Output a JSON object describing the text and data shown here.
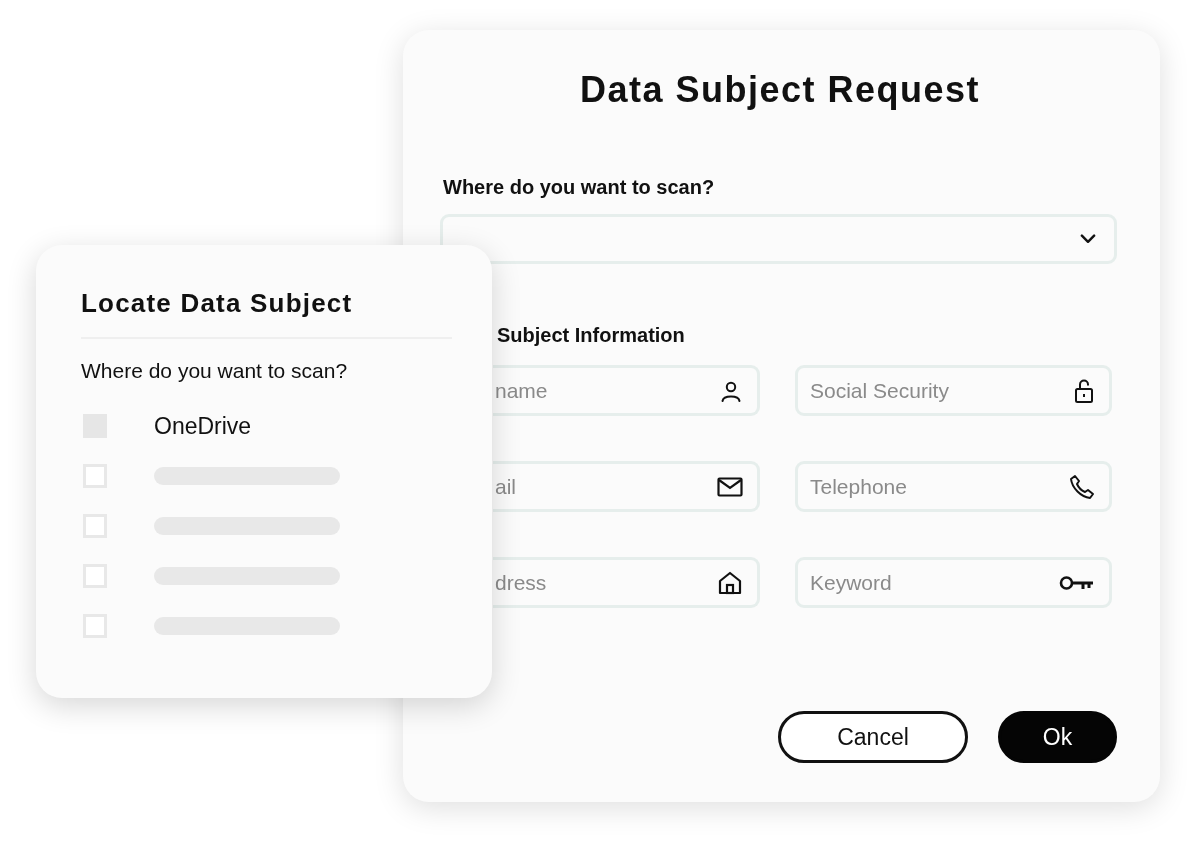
{
  "dialog": {
    "title": "Data Subject Request",
    "scan_label": "Where do you want to scan?",
    "section_title": "Subject Information",
    "fields": [
      {
        "placeholder": "name"
      },
      {
        "placeholder": "Social Security"
      },
      {
        "placeholder": "ail"
      },
      {
        "placeholder": "Telephone"
      },
      {
        "placeholder": "dress"
      },
      {
        "placeholder": "Keyword"
      }
    ],
    "buttons": [
      {
        "label": "Cancel",
        "kind": "secondary"
      },
      {
        "label": "Ok",
        "kind": "primary"
      }
    ]
  },
  "locate_card": {
    "title": "Locate Data Subject",
    "question": "Where do you want to scan?",
    "options": [
      {
        "kind": "text",
        "label": "OneDrive",
        "checked": true
      },
      {
        "kind": "skeleton",
        "checked": false
      },
      {
        "kind": "skeleton",
        "checked": false
      },
      {
        "kind": "skeleton",
        "checked": false
      },
      {
        "kind": "skeleton",
        "checked": false
      }
    ]
  }
}
